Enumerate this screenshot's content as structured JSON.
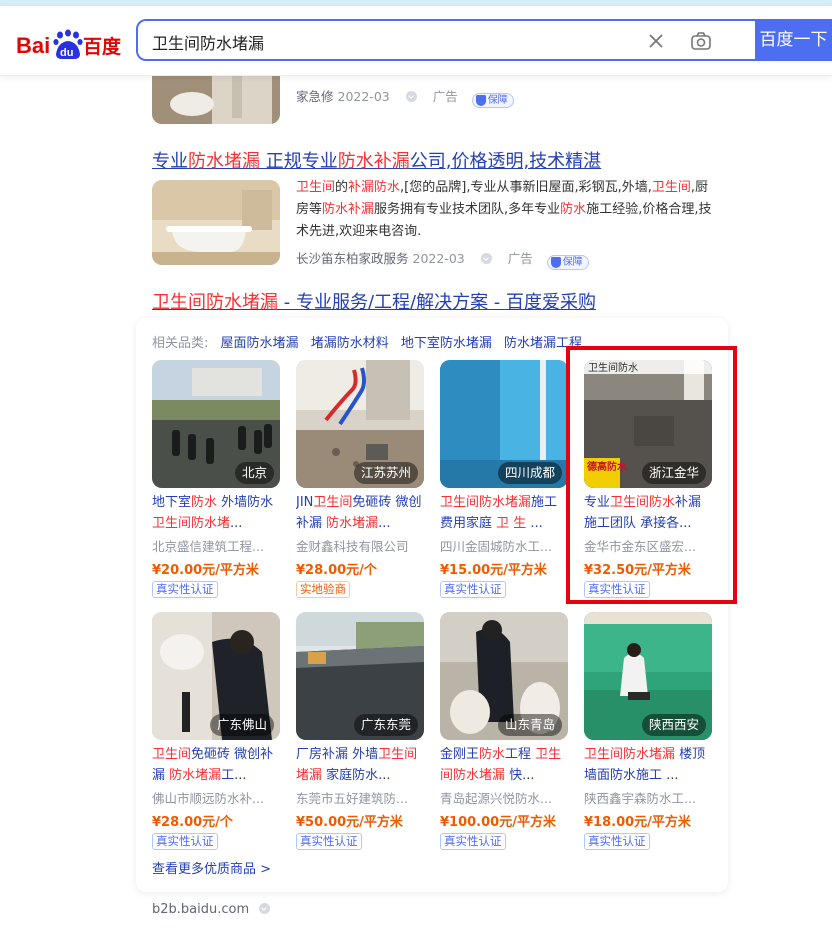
{
  "header": {
    "logo_text_a": "Bai",
    "logo_text_b": "du",
    "logo_text_c": "百度",
    "query": "卫生间防水堵漏",
    "search_button": "百度一下"
  },
  "result0": {
    "source": "家急修",
    "date": "2022-03",
    "ad": "广告",
    "guarantee": "保障"
  },
  "result1": {
    "title_parts": [
      "专业",
      "防水堵漏",
      " 正规专业",
      "防水补漏",
      "公司,价格透明,技术精湛"
    ],
    "abstract_parts": [
      "卫生间",
      "的",
      "补漏防水",
      ",[您的品牌],专业从事新旧屋面,彩钢瓦,外墙,",
      "卫生间",
      ",厨房等",
      "防水补漏",
      "服务拥有专业技术团队,多年专业",
      "防水",
      "施工经验,价格合理,技术先进,欢迎来电咨询."
    ],
    "source": "长沙笛东柏家政服务",
    "date": "2022-03",
    "ad": "广告",
    "guarantee": "保障"
  },
  "result2": {
    "title_parts": [
      "卫生间防水堵漏",
      " - 专业服务/工程/解决方案 - 百度爱采购"
    ]
  },
  "card": {
    "categories_label": "相关品类:",
    "categories": [
      "屋面防水堵漏",
      "堵漏防水材料",
      "地下室防水堵漏",
      "防水堵漏工程"
    ],
    "more": "查看更多优质商品 >"
  },
  "products": [
    {
      "location": "北京",
      "name_parts": [
        "地下室",
        "防水",
        " 外墙防水 ",
        "卫生间防水堵",
        "..."
      ],
      "seller": "北京盛信建筑工程...",
      "price": "¥20.00元/平方米",
      "badge": "真实性认证",
      "badge_type": "blue"
    },
    {
      "location": "江苏苏州",
      "name_parts": [
        "JIN",
        "卫生间",
        "免砸砖 微创补漏 ",
        "防水堵漏",
        "..."
      ],
      "seller": "金财鑫科技有限公司",
      "price": "¥28.00元/个",
      "badge": "实地验商",
      "badge_type": "orange"
    },
    {
      "location": "四川成都",
      "name_parts": [
        "",
        "卫生间防水堵漏",
        "施工费用家庭 ",
        "卫 生",
        " ..."
      ],
      "seller": "四川金固城防水工...",
      "price": "¥15.00元/平方米",
      "badge": "真实性认证",
      "badge_type": "blue"
    },
    {
      "location": "浙江金华",
      "name_parts": [
        "专业",
        "卫生间防水",
        "补漏施工团队 承接各",
        "",
        "..."
      ],
      "seller": "金华市金东区盛宏...",
      "price": "¥32.50元/平方米",
      "badge": "真实性认证",
      "badge_type": "blue",
      "overlay_text": "卫生间防水",
      "overlay_brand": "德高防水"
    },
    {
      "location": "广东佛山",
      "name_parts": [
        "",
        "卫生间",
        "免砸砖 微创补漏 ",
        "防水堵漏",
        "工..."
      ],
      "seller": "佛山市顺远防水补...",
      "price": "¥28.00元/个",
      "badge": "真实性认证",
      "badge_type": "blue"
    },
    {
      "location": "广东东莞",
      "name_parts": [
        "厂房补漏 外墙",
        "卫生间",
        "",
        "堵漏",
        " 家庭防水..."
      ],
      "seller": "东莞市五好建筑防...",
      "price": "¥50.00元/平方米",
      "badge": "真实性认证",
      "badge_type": "blue"
    },
    {
      "location": "山东青岛",
      "name_parts": [
        "金刚王",
        "防水",
        "工程 ",
        "卫生间防水堵漏",
        " 快..."
      ],
      "seller": "青岛起源兴悦防水...",
      "price": "¥100.00元/平方米",
      "badge": "真实性认证",
      "badge_type": "blue"
    },
    {
      "location": "陕西西安",
      "name_parts": [
        "",
        "卫生间防水堵漏",
        " 楼顶墙面防水施工 ",
        "",
        "..."
      ],
      "seller": "陕西鑫宇森防水工...",
      "price": "¥18.00元/平方米",
      "badge": "真实性认证",
      "badge_type": "blue"
    }
  ],
  "footer": {
    "url": "b2b.baidu.com"
  },
  "colors": {
    "brand_blue": "#4e6ef2",
    "link_blue": "#2440b3",
    "highlight_red": "#f73131",
    "price_orange": "#f05a00",
    "annotation_red": "#e60012"
  }
}
